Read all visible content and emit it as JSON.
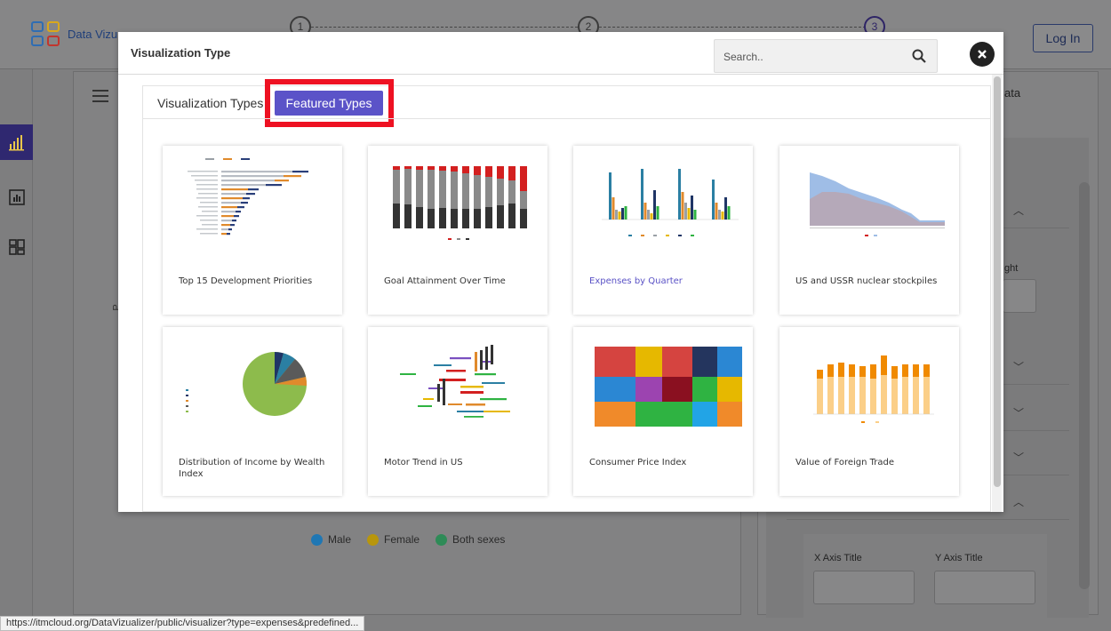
{
  "app": {
    "name": "Data Vizu",
    "steps": [
      "1",
      "2",
      "3"
    ],
    "login_label": "Log In",
    "panel_title": "ata",
    "side_text_1": "ght",
    "axis_x_title": "X Axis Title",
    "axis_y_title": "Y Axis Title",
    "status_url": "https://itmcloud.org/DataVizualizer/public/visualizer?type=expenses&predefined...",
    "legend": [
      {
        "label": "Male",
        "color": "#1f77b4"
      },
      {
        "label": "Female",
        "color": "#b8960c"
      },
      {
        "label": "Both sexes",
        "color": "#2e8b57"
      }
    ]
  },
  "modal": {
    "title": "Visualization Type",
    "search_placeholder": "Search..",
    "tabs": {
      "visualization_types": "Visualization Types",
      "featured_types": "Featured Types"
    },
    "cards": [
      {
        "title": "Top 15 Development Priorities",
        "thumb": "horizontal-bar-chart"
      },
      {
        "title": "Goal Attainment Over Time",
        "thumb": "stacked-column-chart"
      },
      {
        "title": "Expenses by Quarter",
        "thumb": "grouped-column-chart"
      },
      {
        "title": "US and USSR nuclear stockpiles",
        "thumb": "area-chart"
      },
      {
        "title": "Distribution of Income by Wealth Index",
        "thumb": "pie-chart"
      },
      {
        "title": "Motor Trend in US",
        "thumb": "word-cloud"
      },
      {
        "title": "Consumer Price Index",
        "thumb": "treemap"
      },
      {
        "title": "Value of Foreign Trade",
        "thumb": "stacked-bar-chart"
      }
    ]
  },
  "colors": {
    "accent": "#5b53c8",
    "highlight": "#ee1122",
    "link": "#5a52c6"
  }
}
